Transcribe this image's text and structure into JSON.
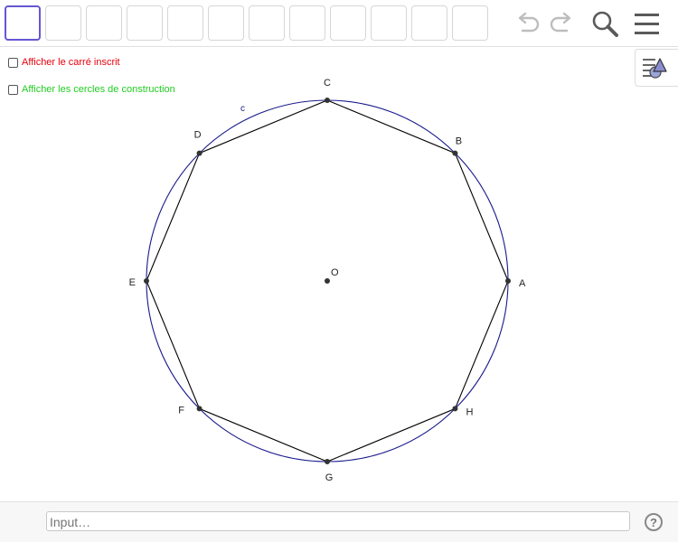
{
  "toolbar": {
    "tool_slots": 12,
    "active_slot": 0
  },
  "icons": {
    "undo": "undo-icon",
    "redo": "redo-icon",
    "search": "search-icon",
    "menu": "menu-icon",
    "algebra_toggle": "algebra-view-toggle-icon",
    "help": "help-icon"
  },
  "checkboxes": [
    {
      "label": "Afficher le carré inscrit",
      "checked": false,
      "color": "#e8000b"
    },
    {
      "label": "Afficher les cercles de construction",
      "checked": false,
      "color": "#22cc22"
    }
  ],
  "construction": {
    "center_label": "O",
    "circle_label": "c",
    "circle_color": "#1a1a8c",
    "polygon_color": "#000000",
    "vertices": [
      "A",
      "B",
      "C",
      "D",
      "E",
      "F",
      "G",
      "H"
    ]
  },
  "input_bar": {
    "placeholder": "Input…",
    "help_symbol": "?"
  }
}
